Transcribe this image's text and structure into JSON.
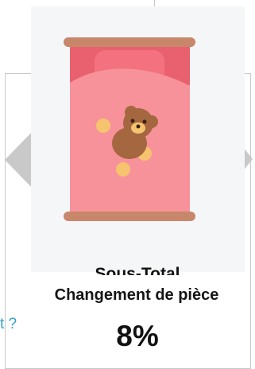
{
  "card": {
    "subtotal_label": "Sous-Total",
    "metric_title": "Changement de pièce",
    "metric_value": "8%"
  },
  "side_text": "t ?",
  "icon": {
    "name": "bed-with-teddy-bear-icon"
  },
  "colors": {
    "frame": "#c8876a",
    "blanket": "#f7929a",
    "pillow": "#ed5a6b",
    "bear": "#a4673f",
    "paw": "#f6c36f",
    "link": "#3aa2c6"
  }
}
